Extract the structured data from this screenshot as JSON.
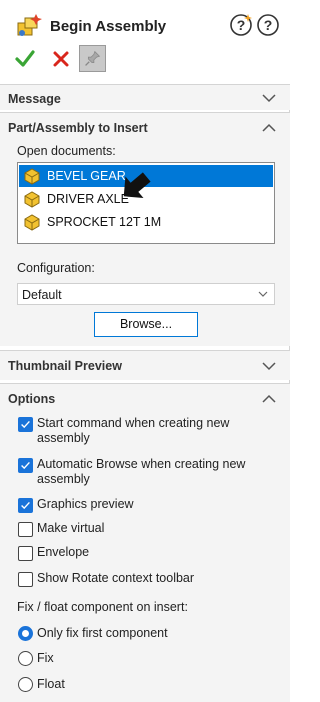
{
  "header": {
    "title": "Begin Assembly",
    "icon": "begin-assembly-icon",
    "help_icons": [
      "whats-new-help-icon",
      "help-icon"
    ],
    "ok_icon": "checkmark-icon",
    "cancel_icon": "x-icon",
    "pin_icon": "pushpin-icon"
  },
  "groups": {
    "message": {
      "title": "Message",
      "state": "collapsed"
    },
    "part_insert": {
      "title": "Part/Assembly to Insert",
      "state": "expanded"
    },
    "thumbnail": {
      "title": "Thumbnail Preview",
      "state": "collapsed"
    },
    "options": {
      "title": "Options",
      "state": "expanded"
    }
  },
  "part_insert": {
    "open_docs_label": "Open documents:",
    "documents": [
      {
        "name": "BEVEL GEAR",
        "selected": true
      },
      {
        "name": "DRIVER AXLE",
        "selected": false
      },
      {
        "name": "SPROCKET 12T 1M",
        "selected": false
      }
    ],
    "configuration_label": "Configuration:",
    "configuration_value": "Default",
    "browse_label": "Browse..."
  },
  "options": {
    "checkboxes": [
      {
        "label": "Start command when creating new assembly",
        "checked": true
      },
      {
        "label": "Automatic Browse when creating new assembly",
        "checked": true
      },
      {
        "label": "Graphics preview",
        "checked": true
      },
      {
        "label": "Make virtual",
        "checked": false
      },
      {
        "label": "Envelope",
        "checked": false
      },
      {
        "label": "Show Rotate context toolbar",
        "checked": false
      }
    ],
    "fix_float_label": "Fix / float component on insert:",
    "radios": [
      {
        "label": "Only fix first component",
        "selected": true
      },
      {
        "label": "Fix",
        "selected": false
      },
      {
        "label": "Float",
        "selected": false
      }
    ]
  },
  "colors": {
    "selection": "#0078d7",
    "checkbox_on": "#1a73d9",
    "ok_green": "#3aa535",
    "cancel_red": "#d9261c",
    "part_yellow": "#f2c230"
  }
}
